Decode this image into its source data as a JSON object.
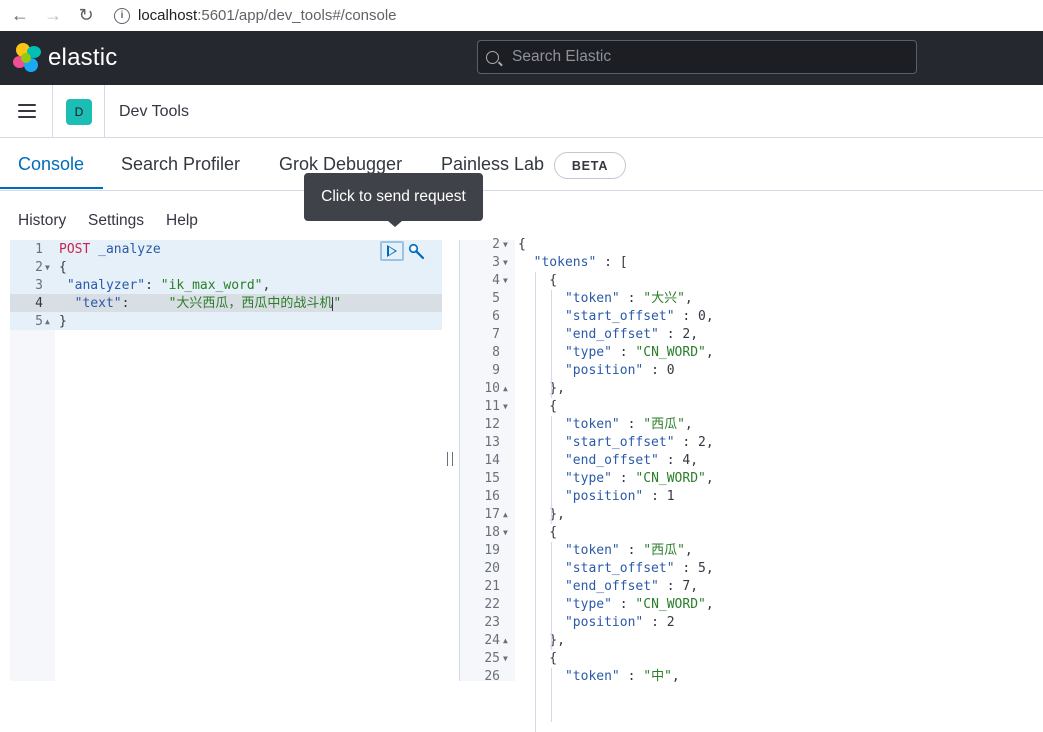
{
  "browser": {
    "url_host": "localhost",
    "url_rest": ":5601/app/dev_tools#/console"
  },
  "header": {
    "brand": "elastic",
    "search_placeholder": "Search Elastic"
  },
  "appbar": {
    "space_initial": "D",
    "title": "Dev Tools"
  },
  "tabs": [
    {
      "label": "Console",
      "active": true
    },
    {
      "label": "Search Profiler",
      "active": false
    },
    {
      "label": "Grok Debugger",
      "active": false
    },
    {
      "label": "Painless Lab",
      "active": false
    }
  ],
  "beta_badge": "BETA",
  "submenu": [
    "History",
    "Settings",
    "Help"
  ],
  "tooltip": "Click to send request",
  "request": {
    "lines": [
      {
        "num": "1",
        "fold": ""
      },
      {
        "num": "2",
        "fold": "down"
      },
      {
        "num": "3",
        "fold": ""
      },
      {
        "num": "4",
        "fold": ""
      },
      {
        "num": "5",
        "fold": "up"
      }
    ],
    "method": "POST",
    "endpoint": "_analyze",
    "open_brace": "{",
    "analyzer_key": "\"analyzer\"",
    "analyzer_val": "\"ik_max_word\"",
    "text_key": "\"text\"",
    "text_val": "\"大兴西瓜，西瓜中的战斗机",
    "text_close": "\"",
    "close_brace": "}"
  },
  "response": {
    "lines": [
      {
        "num": "2",
        "fold": "down",
        "text": "{"
      },
      {
        "num": "3",
        "fold": "down",
        "text": "  \"tokens\" : ["
      },
      {
        "num": "4",
        "fold": "down",
        "text": "    {"
      },
      {
        "num": "5",
        "fold": "",
        "key": "\"token\"",
        "val": "\"大兴\"",
        "tail": ","
      },
      {
        "num": "6",
        "fold": "",
        "key": "\"start_offset\"",
        "val": "0",
        "tail": ","
      },
      {
        "num": "7",
        "fold": "",
        "key": "\"end_offset\"",
        "val": "2",
        "tail": ","
      },
      {
        "num": "8",
        "fold": "",
        "key": "\"type\"",
        "val": "\"CN_WORD\"",
        "tail": ","
      },
      {
        "num": "9",
        "fold": "",
        "key": "\"position\"",
        "val": "0",
        "tail": ""
      },
      {
        "num": "10",
        "fold": "up",
        "text": "    },"
      },
      {
        "num": "11",
        "fold": "down",
        "text": "    {"
      },
      {
        "num": "12",
        "fold": "",
        "key": "\"token\"",
        "val": "\"西瓜\"",
        "tail": ","
      },
      {
        "num": "13",
        "fold": "",
        "key": "\"start_offset\"",
        "val": "2",
        "tail": ","
      },
      {
        "num": "14",
        "fold": "",
        "key": "\"end_offset\"",
        "val": "4",
        "tail": ","
      },
      {
        "num": "15",
        "fold": "",
        "key": "\"type\"",
        "val": "\"CN_WORD\"",
        "tail": ","
      },
      {
        "num": "16",
        "fold": "",
        "key": "\"position\"",
        "val": "1",
        "tail": ""
      },
      {
        "num": "17",
        "fold": "up",
        "text": "    },"
      },
      {
        "num": "18",
        "fold": "down",
        "text": "    {"
      },
      {
        "num": "19",
        "fold": "",
        "key": "\"token\"",
        "val": "\"西瓜\"",
        "tail": ","
      },
      {
        "num": "20",
        "fold": "",
        "key": "\"start_offset\"",
        "val": "5",
        "tail": ","
      },
      {
        "num": "21",
        "fold": "",
        "key": "\"end_offset\"",
        "val": "7",
        "tail": ","
      },
      {
        "num": "22",
        "fold": "",
        "key": "\"type\"",
        "val": "\"CN_WORD\"",
        "tail": ","
      },
      {
        "num": "23",
        "fold": "",
        "key": "\"position\"",
        "val": "2",
        "tail": ""
      },
      {
        "num": "24",
        "fold": "up",
        "text": "    },"
      },
      {
        "num": "25",
        "fold": "down",
        "text": "    {"
      },
      {
        "num": "26",
        "fold": "",
        "key": "\"token\"",
        "val": "\"中\"",
        "tail": ","
      }
    ]
  },
  "colors": {
    "accent": "#006bb8",
    "header_bg": "#25282f",
    "space_avatar": "#1bbdb5",
    "string": "#2a7e2a",
    "method": "#c7254e"
  },
  "icons": {
    "back": "arrow-left-icon",
    "forward": "arrow-right-icon",
    "reload": "reload-icon",
    "info": "info-icon",
    "logo": "elastic-logo-icon",
    "search": "search-icon",
    "menu": "hamburger-menu-icon",
    "send": "play-icon",
    "wrench": "wrench-icon"
  }
}
